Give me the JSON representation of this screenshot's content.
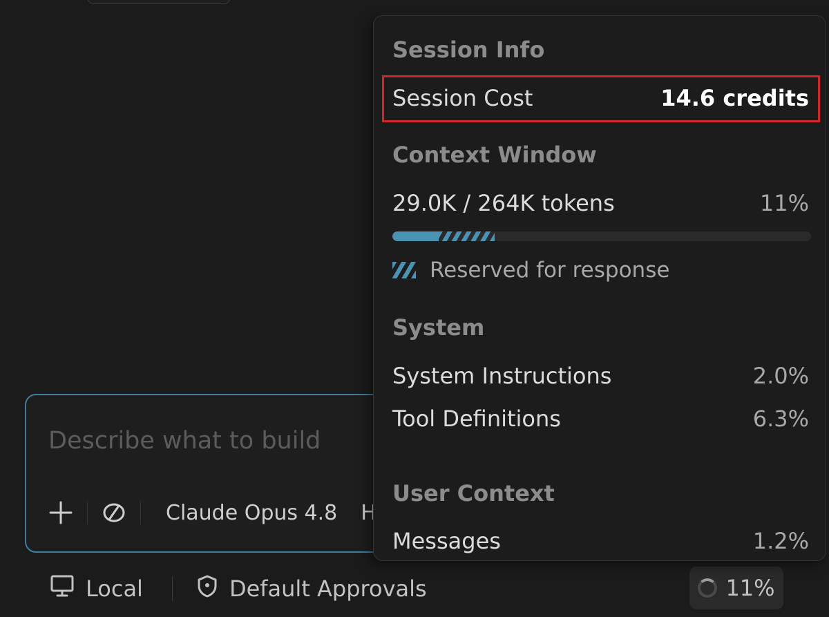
{
  "composer": {
    "placeholder": "Describe what to build",
    "add_icon": "plus-icon",
    "attach_icon": "context-icon",
    "model": "Claude Opus 4.8",
    "mode_truncated": "H"
  },
  "status_bar": {
    "environment_icon": "monitor-icon",
    "environment": "Local",
    "approvals_icon": "shield-icon",
    "approvals": "Default Approvals",
    "context_indicator": "11%",
    "context_indicator_icon": "progress-ring-icon"
  },
  "session_info": {
    "title": "Session Info",
    "session_cost": {
      "label": "Session Cost",
      "value": "14.6 credits",
      "highlight_color": "#d6262d"
    },
    "context_window": {
      "title": "Context Window",
      "usage_label": "29.0K / 264K tokens",
      "percent_label": "11%",
      "used_fraction": 0.11,
      "reserved_fraction": 0.245,
      "bar_color": "#4a93b4",
      "reserved_legend": "Reserved for response"
    },
    "system": {
      "title": "System",
      "items": [
        {
          "label": "System Instructions",
          "value": "2.0%"
        },
        {
          "label": "Tool Definitions",
          "value": "6.3%"
        }
      ]
    },
    "user_context": {
      "title": "User Context",
      "items": [
        {
          "label": "Messages",
          "value": "1.2%"
        }
      ]
    }
  }
}
